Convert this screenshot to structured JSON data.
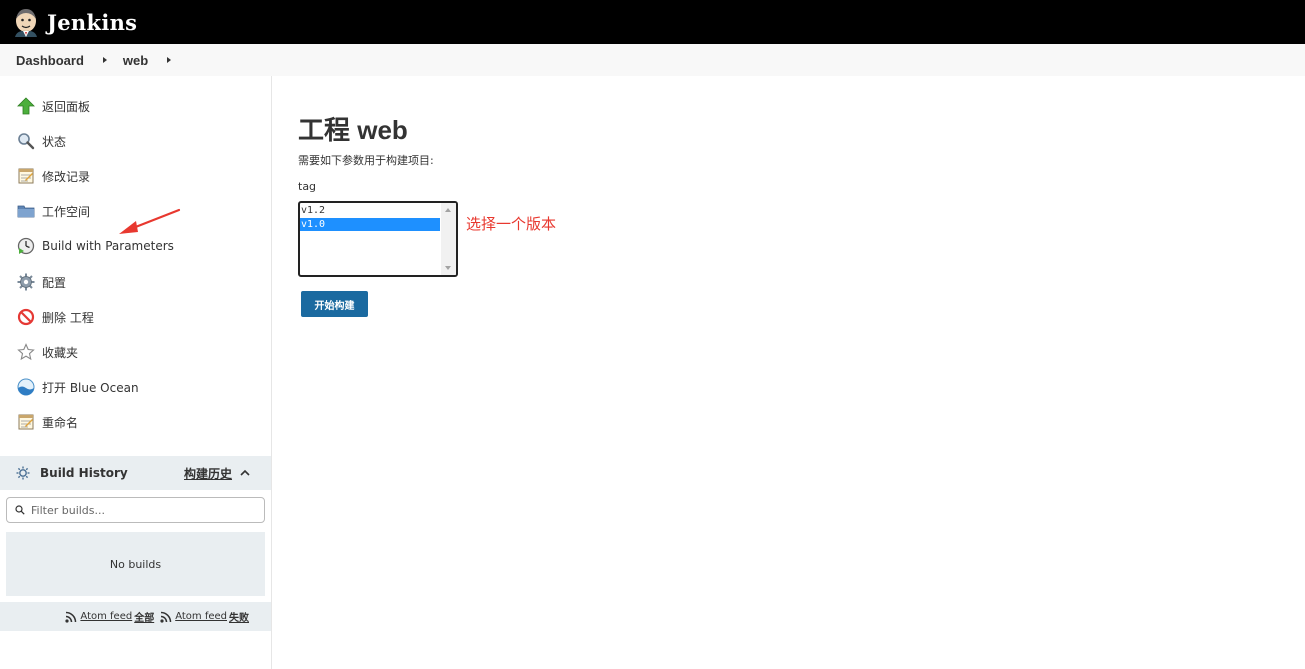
{
  "header": {
    "brand": "Jenkins"
  },
  "breadcrumb": {
    "items": [
      "Dashboard",
      "web"
    ]
  },
  "sidebar": {
    "tasks": [
      {
        "label": "返回面板",
        "icon": "up-arrow-icon"
      },
      {
        "label": "状态",
        "icon": "search-icon"
      },
      {
        "label": "修改记录",
        "icon": "notepad-icon"
      },
      {
        "label": "工作空间",
        "icon": "folder-icon"
      },
      {
        "label": "Build with Parameters",
        "icon": "build-clock-icon"
      },
      {
        "label": "配置",
        "icon": "gear-icon"
      },
      {
        "label": "删除 工程",
        "icon": "no-entry-icon"
      },
      {
        "label": "收藏夹",
        "icon": "star-icon"
      },
      {
        "label": "打开 Blue Ocean",
        "icon": "blue-ocean-icon"
      },
      {
        "label": "重命名",
        "icon": "notepad-icon"
      }
    ]
  },
  "build_history": {
    "title": "Build History",
    "link": "构建历史",
    "filter_placeholder": "Filter builds...",
    "empty_text": "No builds",
    "feeds": [
      {
        "prefix": "Atom feed",
        "label": "全部"
      },
      {
        "prefix": "Atom feed",
        "label": "失败"
      }
    ]
  },
  "main": {
    "title": "工程 web",
    "description": "需要如下参数用于构建项目:",
    "param_name": "tag",
    "options": [
      "v1.2",
      "v1.0"
    ],
    "selected_option": "v1.0",
    "annotation": "选择一个版本",
    "build_button": "开始构建"
  },
  "colors": {
    "header_bg": "#000000",
    "breadcrumb_bg": "#f8f8f8",
    "panel_bg": "#e9eef1",
    "selected_option": "#1e90ff",
    "build_button": "#1b6aa0",
    "annotation": "#e8382f"
  }
}
